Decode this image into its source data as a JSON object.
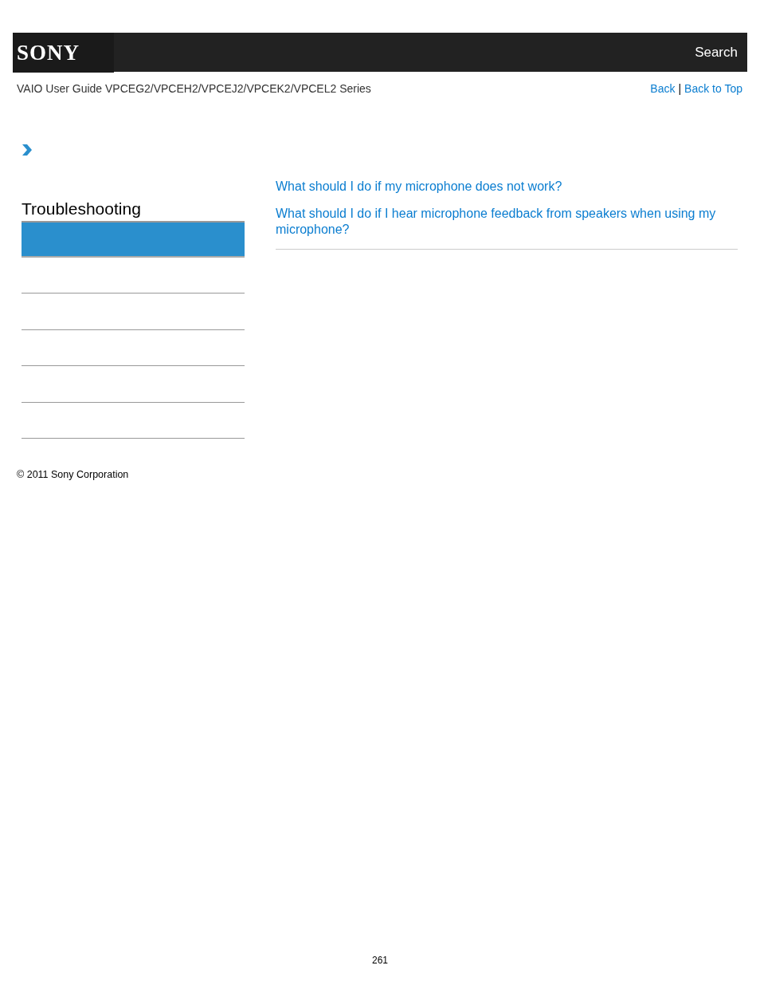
{
  "header": {
    "logo": "SONY",
    "search": "Search"
  },
  "guide_title": "VAIO User Guide VPCEG2/VPCEH2/VPCEJ2/VPCEK2/VPCEL2 Series",
  "nav_links": [
    {
      "label": "Back",
      "separator": "|"
    },
    {
      "label": "Back to Top"
    }
  ],
  "sidebar": {
    "heading": "Troubleshooting",
    "items": [
      {
        "selected": true
      },
      {
        "selected": false
      },
      {
        "selected": false
      },
      {
        "selected": false
      },
      {
        "selected": false
      },
      {
        "selected": false
      }
    ]
  },
  "topics": [
    {
      "label": "What should I do if my microphone does not work?"
    },
    {
      "label": "What should I do if I hear microphone feedback from speakers when using my microphone?"
    }
  ],
  "copyright": "© 2011 Sony Corporation",
  "page_number": "261"
}
